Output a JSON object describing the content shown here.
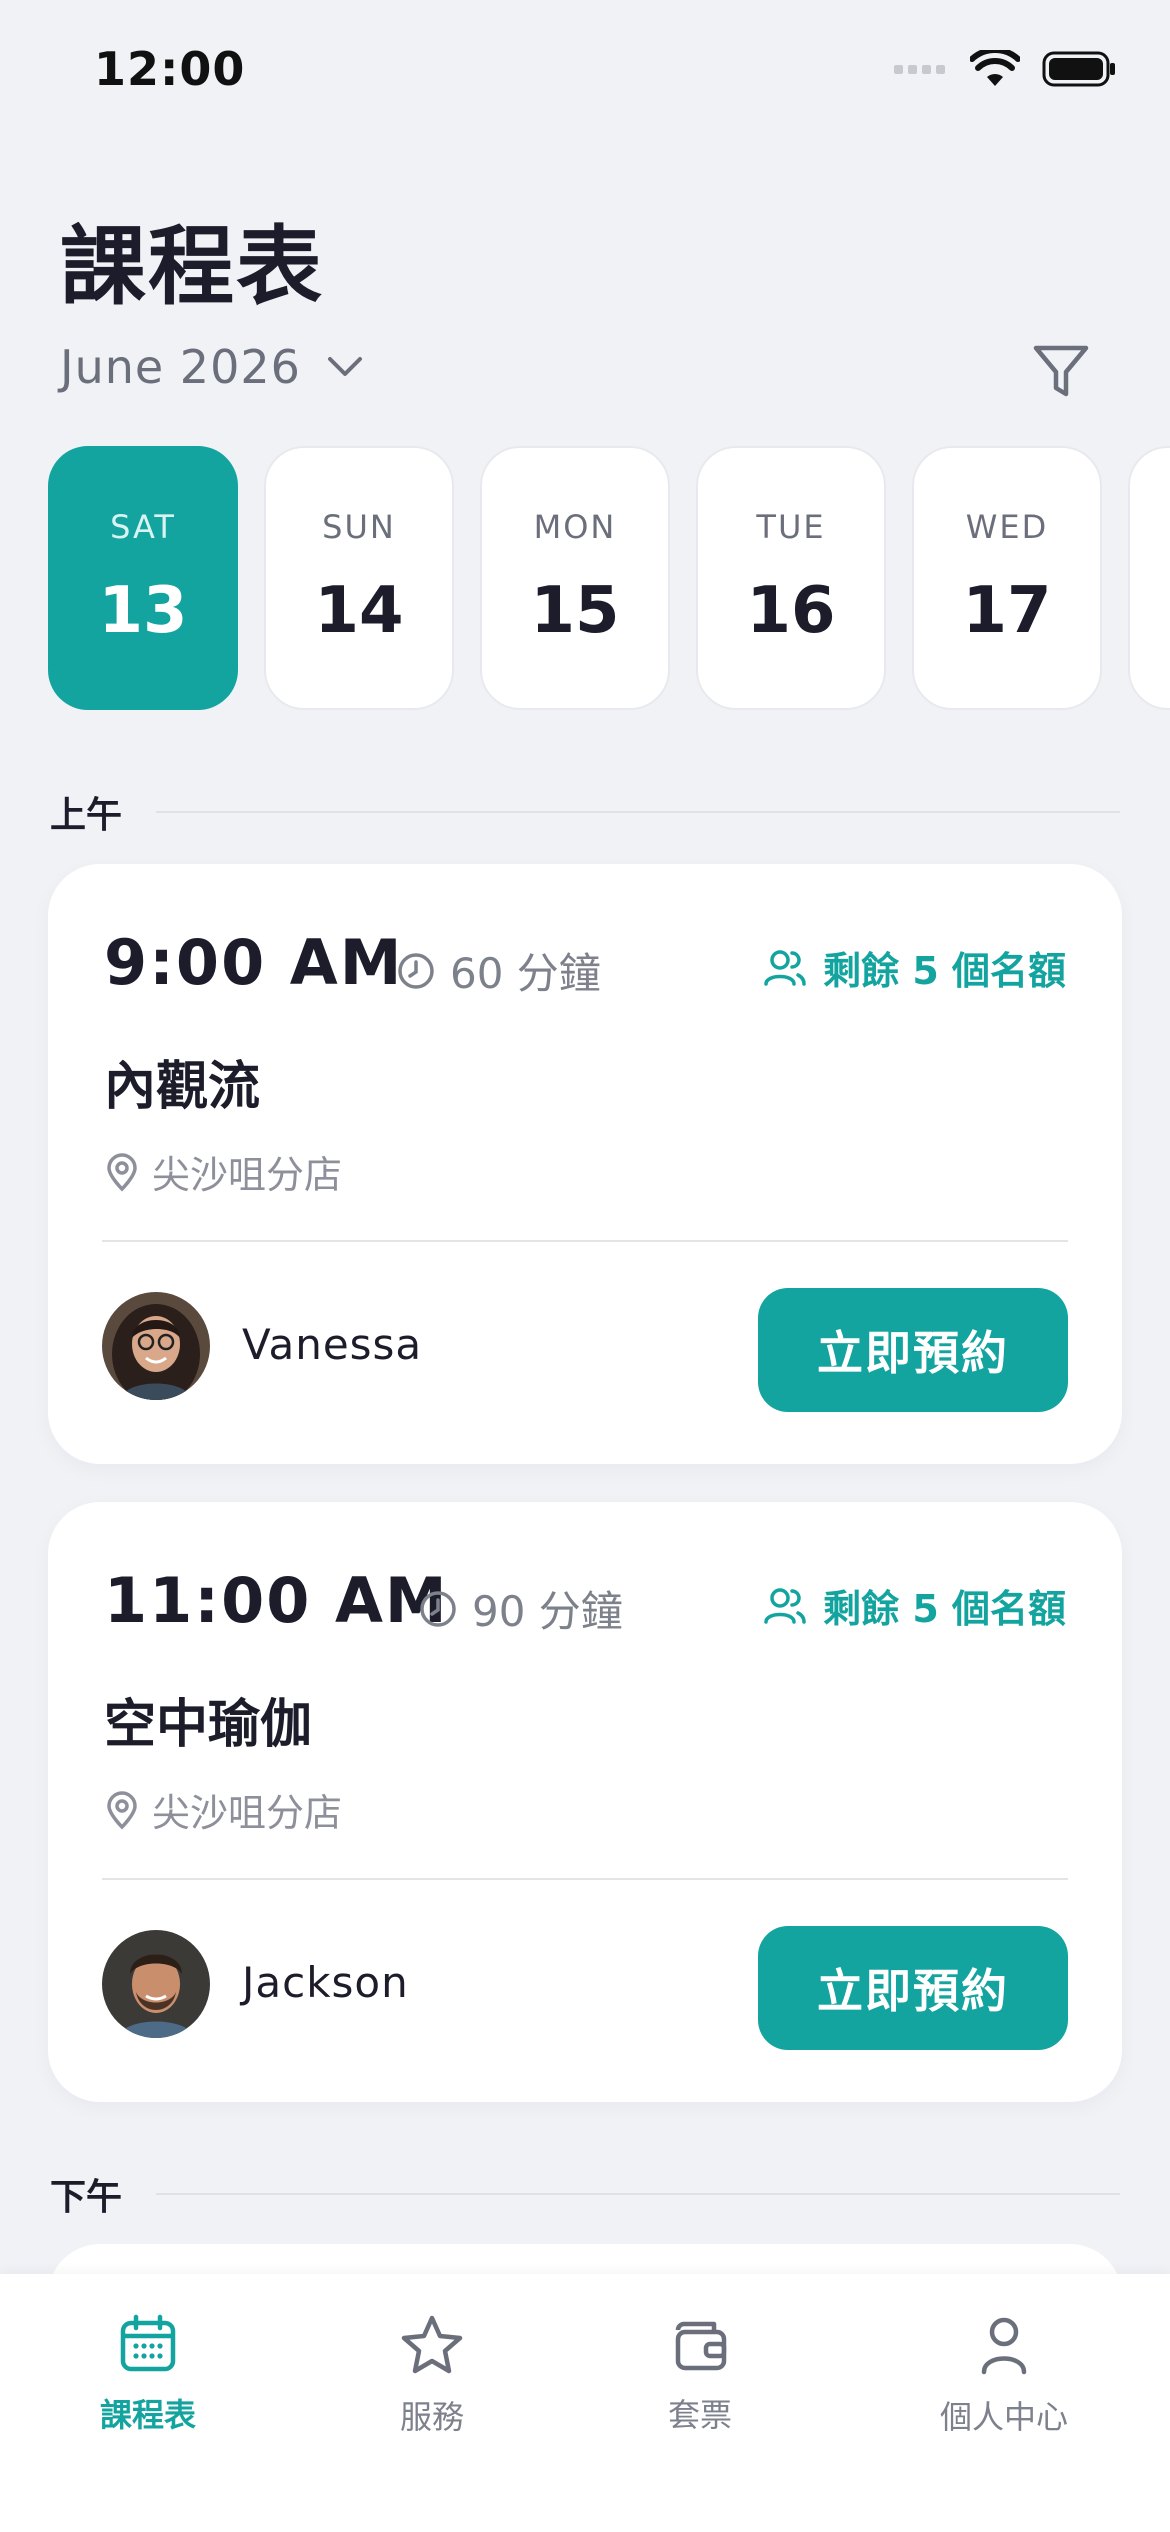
{
  "status_bar": {
    "time": "12:00"
  },
  "header": {
    "title": "課程表",
    "month": "June 2026"
  },
  "dates": [
    {
      "dow": "SAT",
      "day": "13",
      "active": true
    },
    {
      "dow": "SUN",
      "day": "14"
    },
    {
      "dow": "MON",
      "day": "15"
    },
    {
      "dow": "TUE",
      "day": "16"
    },
    {
      "dow": "WED",
      "day": "17"
    }
  ],
  "sections": {
    "morning": "上午",
    "afternoon": "下午"
  },
  "classes": [
    {
      "time": "9:00 AM",
      "duration": "60 分鐘",
      "spots": "剩餘 5 個名額",
      "name": "內觀流",
      "location": "尖沙咀分店",
      "teacher": "Vanessa",
      "cta": "立即預約"
    },
    {
      "time": "11:00 AM",
      "duration": "90 分鐘",
      "spots": "剩餘 5 個名額",
      "name": "空中瑜伽",
      "location": "尖沙咀分店",
      "teacher": "Jackson",
      "cta": "立即預約"
    }
  ],
  "tabs": [
    {
      "label": "課程表",
      "icon": "calendar-icon",
      "active": true
    },
    {
      "label": "服務",
      "icon": "star-icon"
    },
    {
      "label": "套票",
      "icon": "wallet-icon"
    },
    {
      "label": "個人中心",
      "icon": "user-icon"
    }
  ],
  "colors": {
    "accent": "#14a4a0",
    "background": "#f1f2f6",
    "text": "#1c1c2b"
  }
}
